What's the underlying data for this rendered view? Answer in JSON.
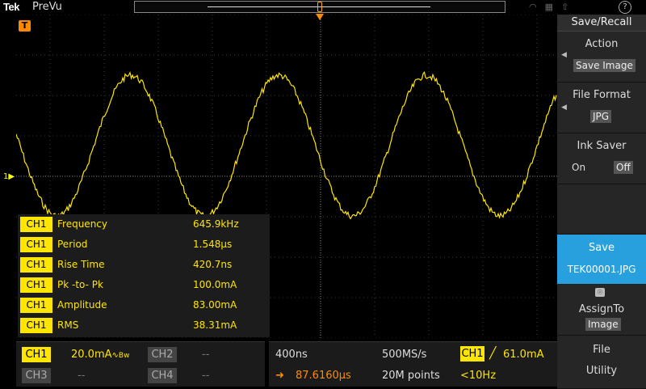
{
  "topbar": {
    "logo": "Tek",
    "mode": "PreVu",
    "help": "?"
  },
  "channel_marker": "1",
  "trigger_marker": "T",
  "measurements": [
    {
      "ch": "CH1",
      "name": "Frequency",
      "value": "645.9kHz"
    },
    {
      "ch": "CH1",
      "name": "Period",
      "value": "1.548µs"
    },
    {
      "ch": "CH1",
      "name": "Rise Time",
      "value": "420.7ns"
    },
    {
      "ch": "CH1",
      "name": "Pk -to- Pk",
      "value": "100.0mA"
    },
    {
      "ch": "CH1",
      "name": "Amplitude",
      "value": "83.00mA"
    },
    {
      "ch": "CH1",
      "name": "RMS",
      "value": "38.31mA"
    }
  ],
  "channels": {
    "ch1": {
      "label": "CH1",
      "scale": "20.0mA",
      "bw": "Bw"
    },
    "ch2": {
      "label": "CH2",
      "scale": "--"
    },
    "ch3": {
      "label": "CH3",
      "scale": "--"
    },
    "ch4": {
      "label": "CH4",
      "scale": "--"
    }
  },
  "horizontal": {
    "timebase": "400ns",
    "sample_rate": "500MS/s",
    "position": "87.6160µs",
    "record_length": "20M points"
  },
  "trigger": {
    "source": "CH1",
    "level": "61.0mA",
    "freq": "<10Hz"
  },
  "menu": {
    "title": "Save/Recall",
    "action_label": "Action",
    "action_value": "Save Image",
    "format_label": "File Format",
    "format_value": "JPG",
    "ink_label": "Ink Saver",
    "ink_on": "On",
    "ink_off": "Off",
    "save_label": "Save",
    "save_file": "TEK00001.JPG",
    "assign_label": "AssignTo",
    "assign_value": "Image",
    "file_label": "File",
    "utility_label": "Utility"
  },
  "colors": {
    "ch1": "#ffe600",
    "trigger": "#ff8c00",
    "save_highlight": "#28a0dd"
  }
}
